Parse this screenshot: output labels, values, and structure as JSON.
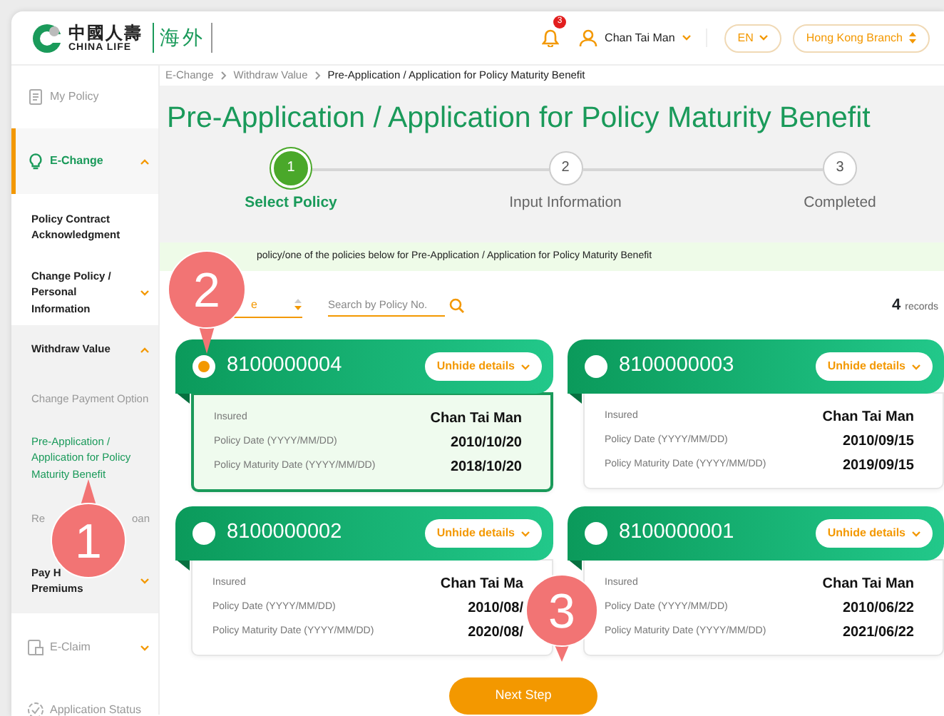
{
  "header": {
    "brand_cn": "中國人壽",
    "brand_en": "CHINA LIFE",
    "brand_region": "海外",
    "notification_count": "3",
    "user": "Chan Tai Man",
    "language": "EN",
    "branch": "Hong Kong Branch"
  },
  "sidebar": {
    "items": [
      {
        "kind": "document",
        "label_parts": [
          "My Policy"
        ],
        "selected": false
      },
      {
        "kind": "bulb",
        "label_parts": [
          "E-Change"
        ],
        "selected": true,
        "expanded": true,
        "children": [
          {
            "kind": "group",
            "label_parts": [
              "Policy Contract Acknowledgment"
            ]
          },
          {
            "kind": "group",
            "label_parts": [
              "Change Policy / Personal Information"
            ],
            "expanded": false
          },
          {
            "kind": "group",
            "label_parts": [
              "Withdraw Value"
            ],
            "expanded": true,
            "children": [
              {
                "kind": "sub",
                "label_parts": [
                  "Change Payment Option"
                ],
                "selected": false
              },
              {
                "kind": "sub",
                "label_parts": [
                  "Pre-Application / Application for Policy Maturity Benefit"
                ],
                "selected": true
              },
              {
                "kind": "sub",
                "label_parts": [
                  "Re",
                  "oan"
                ],
                "selected": false
              }
            ]
          },
          {
            "kind": "group",
            "label_parts": [
              "Pay H",
              "Premiums"
            ],
            "expanded": false
          }
        ]
      },
      {
        "kind": "claim",
        "label_parts": [
          "E-Claim"
        ],
        "selected": false,
        "expanded": false
      },
      {
        "kind": "status",
        "label_parts": [
          "Application Status"
        ],
        "selected": false
      }
    ]
  },
  "breadcrumb": [
    "E-Change",
    "Withdraw Value",
    "Pre-Application / Application for Policy Maturity Benefit"
  ],
  "title": "Pre-Application / Application for Policy Maturity Benefit",
  "steps": [
    {
      "number": "1",
      "label": "Select Policy",
      "selected": true
    },
    {
      "number": "2",
      "label": "Input Information",
      "selected": false
    },
    {
      "number": "3",
      "label": "Completed",
      "selected": false
    }
  ],
  "notice": "policy/one of the policies below for Pre-Application / Application for Policy Maturity Benefit",
  "filters": {
    "sort_value": "e",
    "search_placeholder": "Search by Policy No.",
    "record_count": "4",
    "record_label": "records"
  },
  "policies": [
    {
      "number": "8100000004",
      "selected": true,
      "toggle": "Unhide details",
      "rows": [
        {
          "label": "Insured",
          "value": "Chan Tai Man"
        },
        {
          "label": "Policy Date (YYYY/MM/DD)",
          "value": "2010/10/20"
        },
        {
          "label": "Policy Maturity Date (YYYY/MM/DD)",
          "value": "2018/10/20"
        }
      ]
    },
    {
      "number": "8100000003",
      "selected": false,
      "toggle": "Unhide details",
      "rows": [
        {
          "label": "Insured",
          "value": "Chan Tai Man"
        },
        {
          "label": "Policy Date (YYYY/MM/DD)",
          "value": "2010/09/15"
        },
        {
          "label": "Policy Maturity Date (YYYY/MM/DD)",
          "value": "2019/09/15"
        }
      ]
    },
    {
      "number": "8100000002",
      "selected": false,
      "toggle": "Unhide details",
      "rows": [
        {
          "label": "Insured",
          "value": "Chan Tai Ma"
        },
        {
          "label": "Policy Date (YYYY/MM/DD)",
          "value": "2010/08/"
        },
        {
          "label": "Policy Maturity Date (YYYY/MM/DD)",
          "value": "2020/08/"
        }
      ]
    },
    {
      "number": "8100000001",
      "selected": false,
      "toggle": "Unhide details",
      "rows": [
        {
          "label": "Insured",
          "value": "Chan Tai Man"
        },
        {
          "label": "Policy Date (YYYY/MM/DD)",
          "value": "2010/06/22"
        },
        {
          "label": "Policy Maturity Date (YYYY/MM/DD)",
          "value": "2021/06/22"
        }
      ]
    }
  ],
  "next_button": "Next Step",
  "callouts": [
    {
      "number": "1",
      "kind": "up"
    },
    {
      "number": "2",
      "kind": "down"
    },
    {
      "number": "3",
      "kind": "down"
    }
  ]
}
